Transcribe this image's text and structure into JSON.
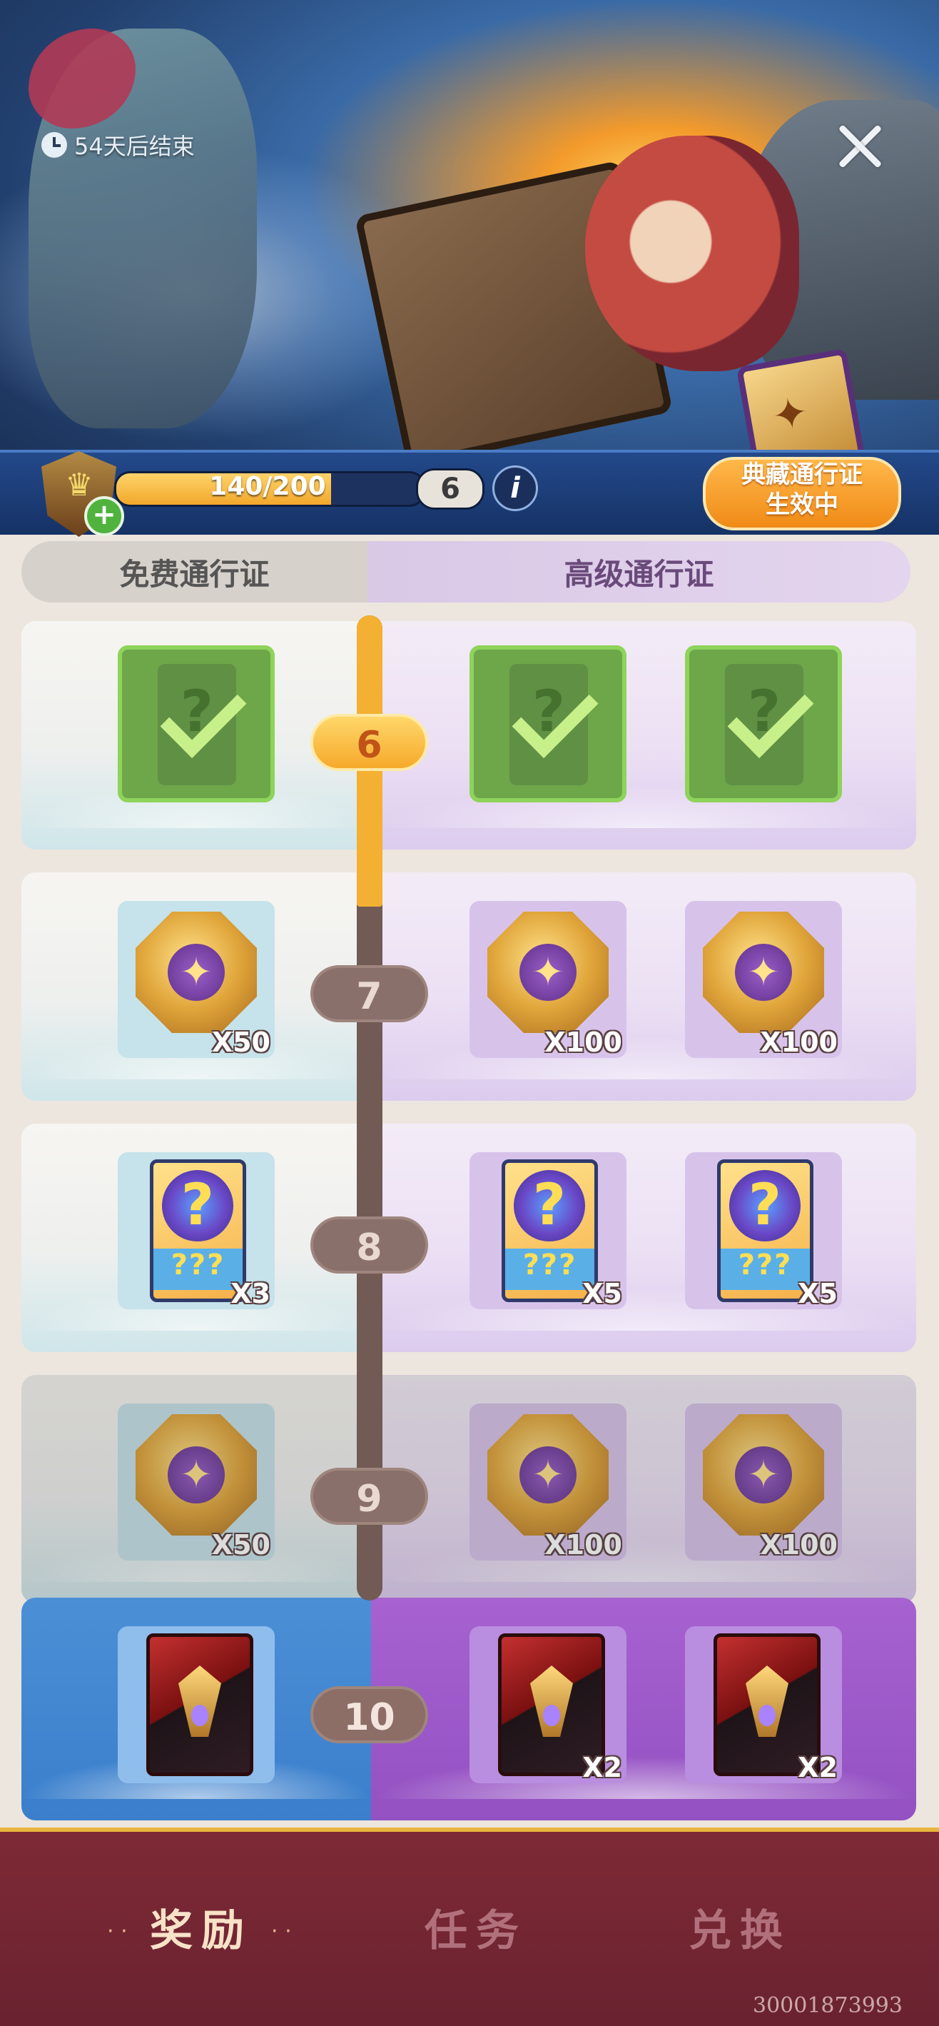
{
  "banner": {
    "timer_text": "54天后结束"
  },
  "progress": {
    "xp_text": "140/200",
    "xp_fraction": 0.7,
    "next_level": "6",
    "info_label": "i",
    "pass_status_line1": "典藏通行证",
    "pass_status_line2": "生效中"
  },
  "tracks": {
    "free_label": "免费通行证",
    "premium_label": "高级通行证"
  },
  "rows": [
    {
      "level": "6",
      "free": {
        "item": "claimed-card",
        "qty": ""
      },
      "premium": [
        {
          "item": "claimed-card",
          "qty": ""
        },
        {
          "item": "claimed-card",
          "qty": ""
        }
      ]
    },
    {
      "level": "7",
      "free": {
        "item": "coin",
        "qty": "X50"
      },
      "premium": [
        {
          "item": "coin",
          "qty": "X100"
        },
        {
          "item": "coin",
          "qty": "X100"
        }
      ]
    },
    {
      "level": "8",
      "free": {
        "item": "mystery-card",
        "qty": "X3"
      },
      "premium": [
        {
          "item": "mystery-card",
          "qty": "X5"
        },
        {
          "item": "mystery-card",
          "qty": "X5"
        }
      ]
    },
    {
      "level": "9",
      "free": {
        "item": "coin",
        "qty": "X50"
      },
      "premium": [
        {
          "item": "coin",
          "qty": "X100"
        },
        {
          "item": "coin",
          "qty": "X100"
        }
      ]
    },
    {
      "level": "10",
      "free": {
        "item": "book",
        "qty": ""
      },
      "premium": [
        {
          "item": "book",
          "qty": "X2"
        },
        {
          "item": "book",
          "qty": "X2"
        }
      ]
    }
  ],
  "card_symbols": {
    "question": "?",
    "triple_question": "???",
    "star": "✦"
  },
  "nav": {
    "rewards": "奖励",
    "tasks": "任务",
    "exchange": "兑换",
    "dot_left": "· ·",
    "dot_right": "· ·"
  },
  "build_id": "30001873993",
  "colors": {
    "accent_gold": "#f3b032",
    "premium_purple": "#9351c2",
    "free_blue": "#3b7fcc",
    "nav_red": "#7d2a35"
  }
}
